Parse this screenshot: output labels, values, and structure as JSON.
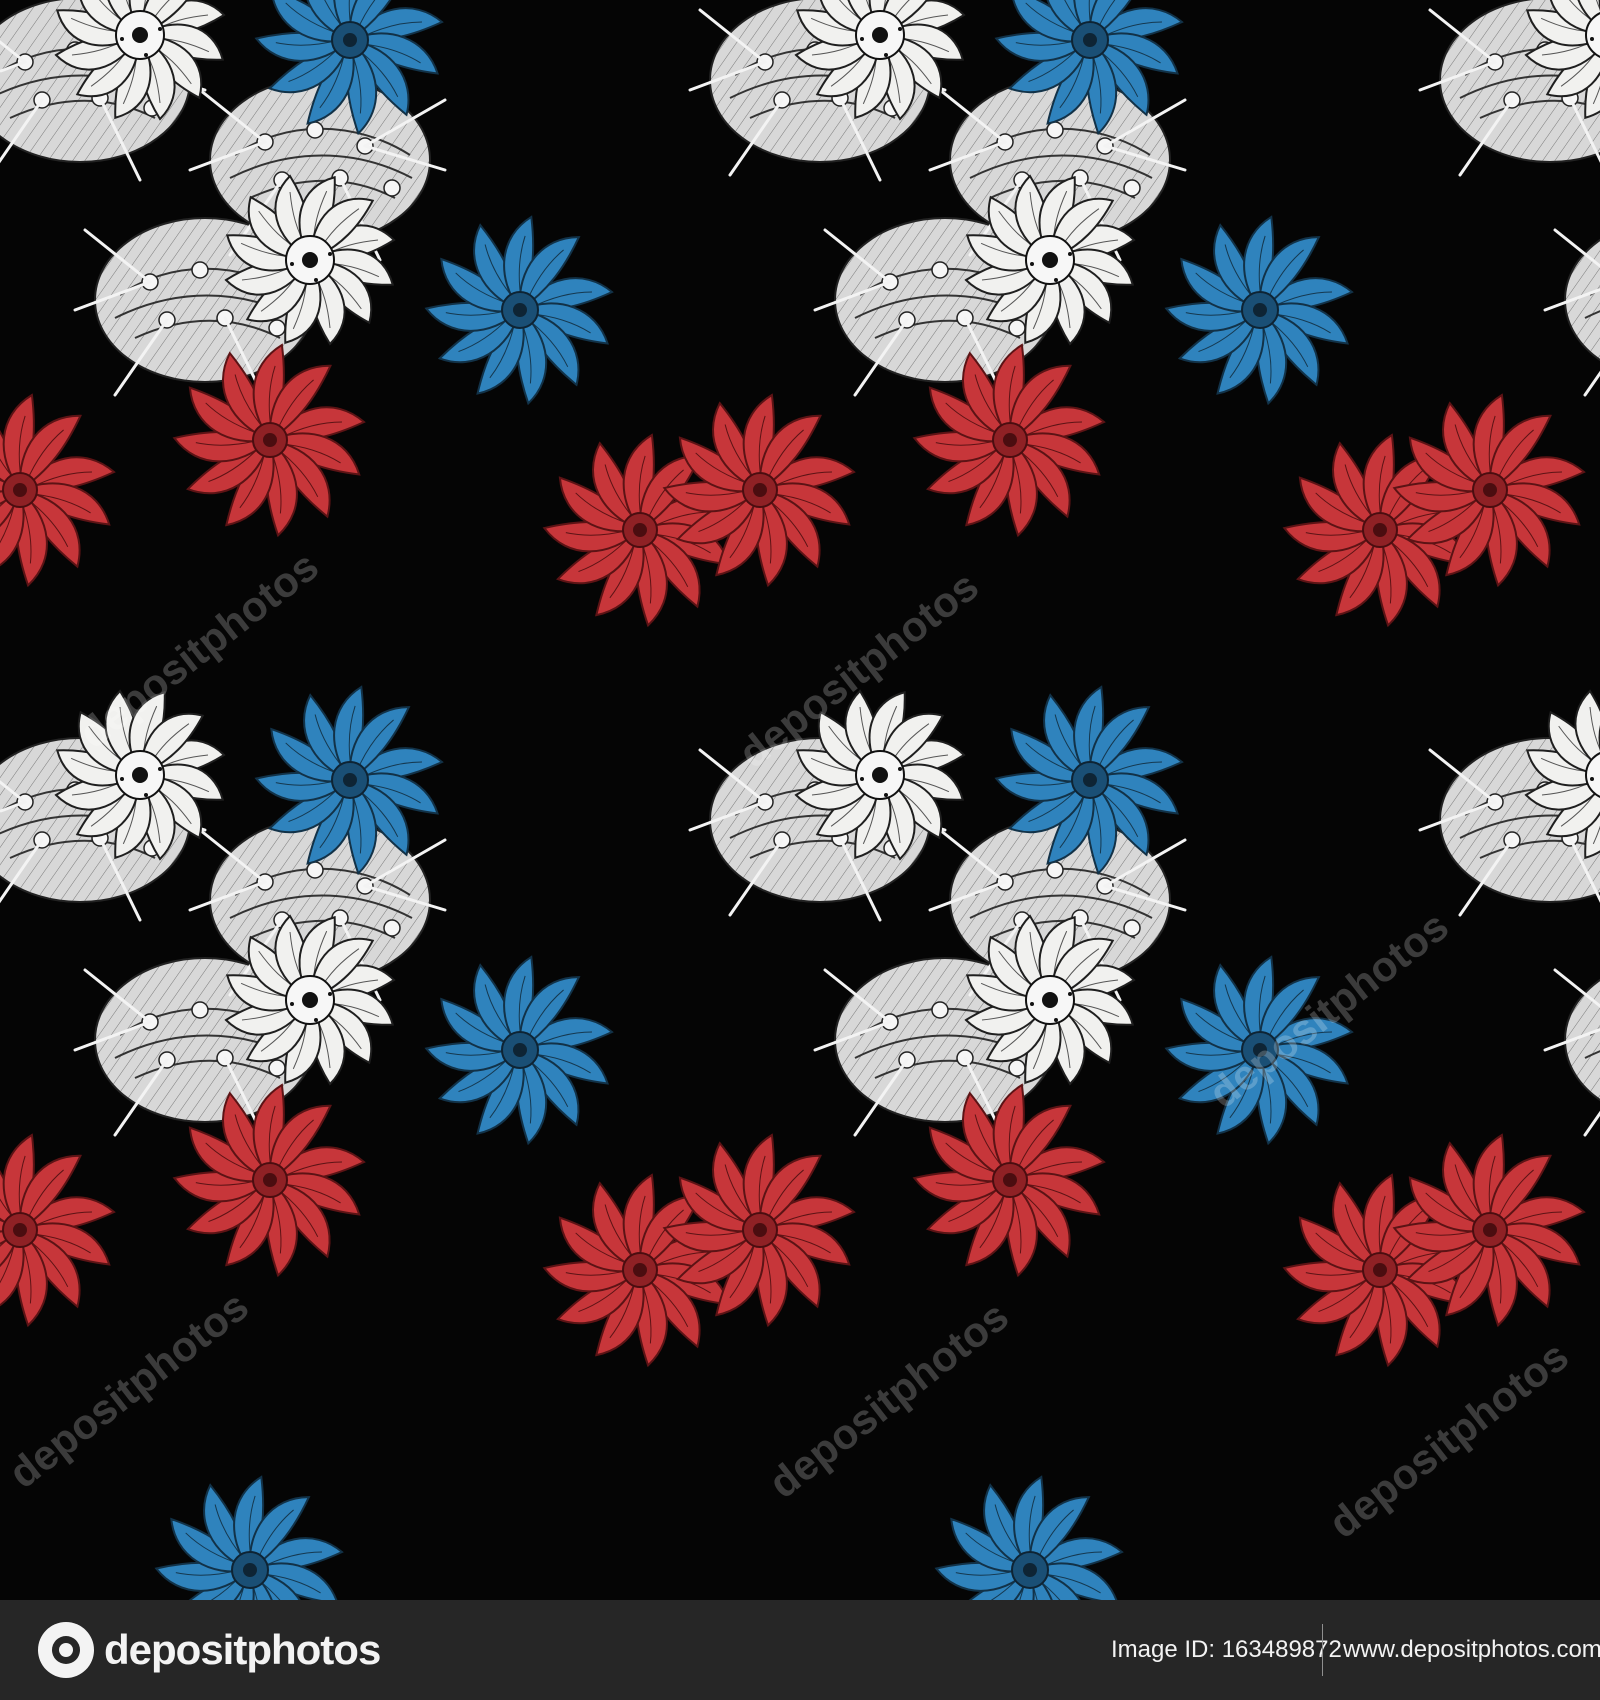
{
  "image": {
    "background_color": "#050505",
    "palette": {
      "white_flower": "#f1f1ef",
      "blue_flower": "#2f83bd",
      "red_flower": "#c7363a",
      "line_art": "#1a1a1a",
      "grey_foliage": "#d8d8d8"
    }
  },
  "watermarks": [
    "depositphotos",
    "depositphotos",
    "depositphotos",
    "depositphotos",
    "depositphotos",
    "depositphotos"
  ],
  "footer": {
    "logo_text": "depositphotos",
    "image_id": "Image ID: 163489872",
    "url": "www.depositphotos.com"
  }
}
